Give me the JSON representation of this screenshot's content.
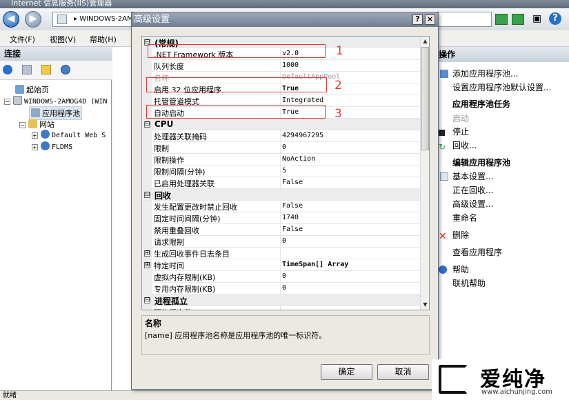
{
  "window": {
    "title": "Internet 信息服务(IIS)管理器"
  },
  "address": {
    "path": "▸ WINDOWS-2AMO"
  },
  "menu": [
    "文件(F)",
    "视图(V)",
    "帮助(H)"
  ],
  "connections": {
    "title": "连接",
    "tree": [
      {
        "label": "起始页",
        "level": 0
      },
      {
        "label": "WINDOWS-2AMOG4D (WIN",
        "level": 0
      },
      {
        "label": "应用程序池",
        "level": 1
      },
      {
        "label": "网站",
        "level": 1
      },
      {
        "label": "Default Web S",
        "level": 2
      },
      {
        "label": "FLDMS",
        "level": 2
      }
    ]
  },
  "actions": {
    "title": "操作",
    "items": [
      {
        "label": "添加应用程序池...",
        "type": "link"
      },
      {
        "label": "设置应用程序池默认设置...",
        "type": "link"
      },
      {
        "label": "应用程序池任务",
        "type": "section"
      },
      {
        "label": "启动",
        "type": "disabled"
      },
      {
        "label": "停止",
        "type": "link"
      },
      {
        "label": "回收...",
        "type": "link"
      },
      {
        "label": "编辑应用程序池",
        "type": "section"
      },
      {
        "label": "基本设置...",
        "type": "link"
      },
      {
        "label": "正在回收...",
        "type": "link"
      },
      {
        "label": "高级设置...",
        "type": "link"
      },
      {
        "label": "重命名",
        "type": "link"
      },
      {
        "label": "删除",
        "type": "link"
      },
      {
        "label": "查看应用程序",
        "type": "link"
      },
      {
        "label": "帮助",
        "type": "link"
      },
      {
        "label": "联机帮助",
        "type": "link"
      }
    ]
  },
  "dialog": {
    "title": "高级设置",
    "help_btn": "?",
    "close_btn": "×",
    "grid": [
      {
        "kind": "cat",
        "label": "(常规)",
        "box": "⊟"
      },
      {
        "kind": "prop",
        "name": ".NET Framework 版本",
        "value": "v2.0"
      },
      {
        "kind": "prop",
        "name": "队列长度",
        "value": "1000"
      },
      {
        "kind": "prop",
        "name": "名称",
        "value": "DefaultAppPool",
        "dim": true
      },
      {
        "kind": "prop",
        "name": "启用 32 位应用程序",
        "value": "True",
        "bold": true
      },
      {
        "kind": "prop",
        "name": "托管管道模式",
        "value": "Integrated"
      },
      {
        "kind": "prop",
        "name": "自动启动",
        "value": "True"
      },
      {
        "kind": "cat",
        "label": "CPU",
        "box": "⊟"
      },
      {
        "kind": "prop",
        "name": "处理器关联掩码",
        "value": "4294967295"
      },
      {
        "kind": "prop",
        "name": "限制",
        "value": "0"
      },
      {
        "kind": "prop",
        "name": "限制操作",
        "value": "NoAction"
      },
      {
        "kind": "prop",
        "name": "限制间隔(分钟)",
        "value": "5"
      },
      {
        "kind": "prop",
        "name": "已启用处理器关联",
        "value": "False"
      },
      {
        "kind": "cat",
        "label": "回收",
        "box": "⊟"
      },
      {
        "kind": "prop",
        "name": "发生配置更改时禁止回收",
        "value": "False"
      },
      {
        "kind": "prop",
        "name": "固定时间间隔(分钟)",
        "value": "1740"
      },
      {
        "kind": "prop",
        "name": "禁用重叠回收",
        "value": "False"
      },
      {
        "kind": "prop",
        "name": "请求限制",
        "value": "0"
      },
      {
        "kind": "prop",
        "name": "生成回收事件日志条目",
        "value": "",
        "box": "⊞"
      },
      {
        "kind": "prop",
        "name": "特定时间",
        "value": "TimeSpan[] Array",
        "bold": true,
        "box": "⊞"
      },
      {
        "kind": "prop",
        "name": "虚拟内存限制(KB)",
        "value": "0"
      },
      {
        "kind": "prop",
        "name": "专用内存限制(KB)",
        "value": "0"
      },
      {
        "kind": "cat",
        "label": "进程孤立",
        "box": "⊟"
      },
      {
        "kind": "prop",
        "name": "可执行文件",
        "value": ""
      }
    ],
    "description": {
      "title": "名称",
      "text": "[name] 应用程序池名称是应用程序池的唯一标识符。"
    },
    "ok_label": "确定",
    "cancel_label": "取消"
  },
  "annotations": [
    "1",
    "2",
    "3"
  ],
  "status": {
    "text": "就绪"
  },
  "watermark": {
    "brand": "爱纯净",
    "url": "www.aichunjing.com"
  }
}
